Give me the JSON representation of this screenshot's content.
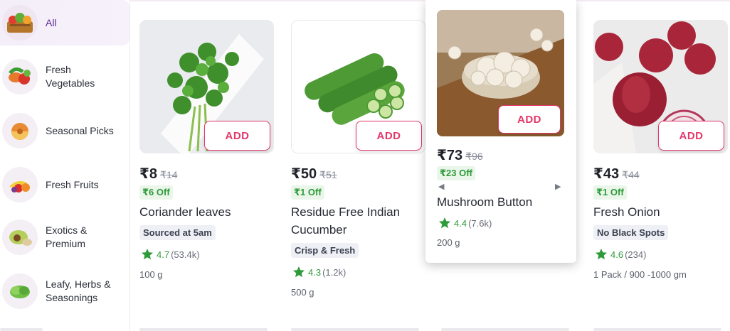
{
  "sidebar": {
    "items": [
      {
        "label": "All",
        "icon": "grocery-basket-icon",
        "active": true
      },
      {
        "label": "Fresh\nVegetables",
        "icon": "vegetables-icon"
      },
      {
        "label": "Seasonal Picks",
        "icon": "melon-icon"
      },
      {
        "label": "Fresh Fruits",
        "icon": "fruits-icon"
      },
      {
        "label": "Exotics &\nPremium",
        "icon": "avocado-icon"
      },
      {
        "label": "Leafy, Herbs &\nSeasonings",
        "icon": "lettuce-icon"
      }
    ]
  },
  "products": [
    {
      "name": "Coriander leaves",
      "price": "₹8",
      "mrp": "₹14",
      "discount": "₹6 Off",
      "tag": "Sourced at 5am",
      "rating": "4.7",
      "rating_count": "(53.4k)",
      "quantity": "100 g",
      "add_label": "ADD",
      "image": "coriander-image"
    },
    {
      "name": "Residue Free Indian Cucumber",
      "price": "₹50",
      "mrp": "₹51",
      "discount": "₹1 Off",
      "tag": "Crisp & Fresh",
      "rating": "4.3",
      "rating_count": "(1.2k)",
      "quantity": "500 g",
      "add_label": "ADD",
      "image": "cucumber-image"
    },
    {
      "name": "Mushroom Button",
      "price": "₹73",
      "mrp": "₹96",
      "discount": "₹23 Off",
      "tag": "",
      "rating": "4.4",
      "rating_count": "(7.6k)",
      "quantity": "200 g",
      "add_label": "ADD",
      "image": "mushroom-image",
      "hovered": true
    },
    {
      "name": "Fresh Onion",
      "price": "₹43",
      "mrp": "₹44",
      "discount": "₹1 Off",
      "tag": "No Black Spots",
      "rating": "4.6",
      "rating_count": "(234)",
      "quantity": "1 Pack / 900 -1000 gm",
      "add_label": "ADD",
      "image": "onion-image"
    }
  ],
  "colors": {
    "accent": "#e2386b",
    "discount_green": "#2e9b3a",
    "active_purple": "#5a2d91"
  }
}
